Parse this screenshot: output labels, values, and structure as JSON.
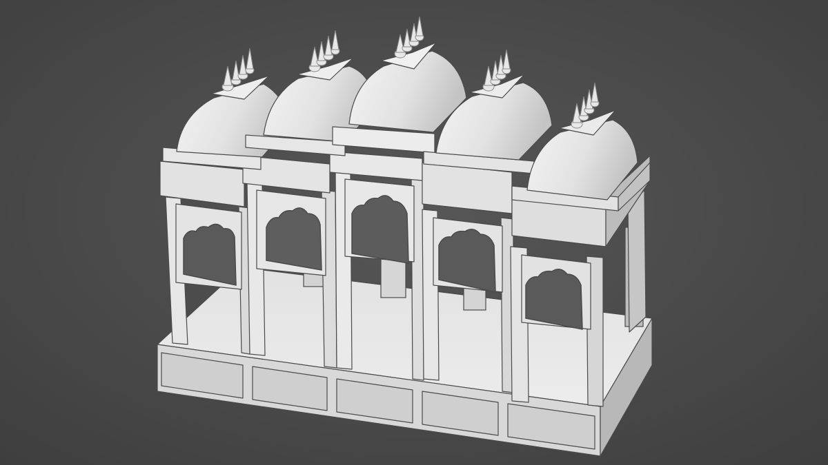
{
  "scene": {
    "subject": "pavilion-3d-render",
    "colors": {
      "background_center": "#575757",
      "background_edge": "#3e3e3e",
      "surface_light": "#eeeeee",
      "surface_mid": "#d6d6d6",
      "surface_shadow": "#bdbdbd",
      "surface_dark": "#9e9e9e",
      "outline": "#4a4a4a",
      "opening": "#5a5a5a"
    }
  }
}
